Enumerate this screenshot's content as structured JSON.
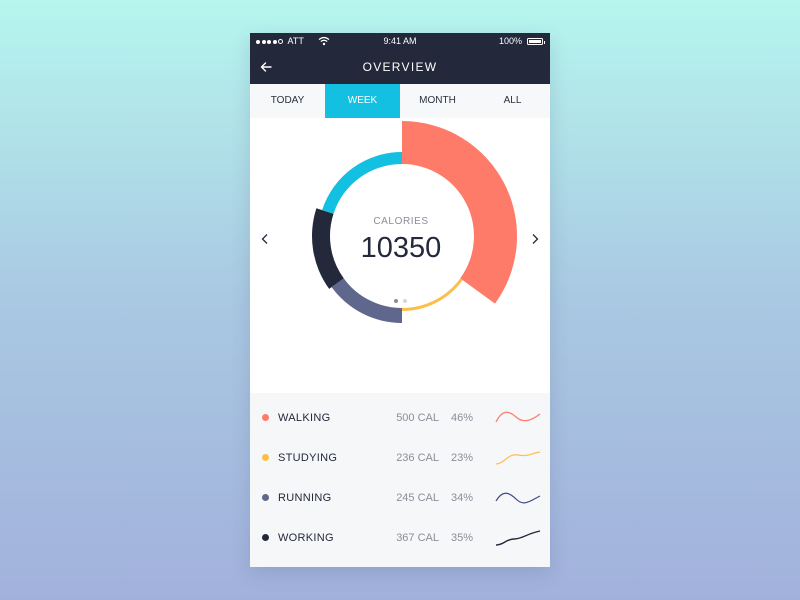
{
  "status_bar": {
    "carrier": "ATT",
    "time": "9:41 AM",
    "battery": "100%",
    "signal_bars_filled": 4,
    "signal_bars_total": 5
  },
  "nav": {
    "title": "OVERVIEW",
    "back_icon": "arrow-left-icon"
  },
  "tabs": [
    {
      "label": "TODAY",
      "active": false
    },
    {
      "label": "WEEK",
      "active": true
    },
    {
      "label": "MONTH",
      "active": false
    },
    {
      "label": "ALL",
      "active": false
    }
  ],
  "summary": {
    "label": "CALORIES",
    "value": "10350",
    "page_count": 2,
    "current_page": 1
  },
  "activities": [
    {
      "name": "WALKING",
      "calories": "500 CAL",
      "percent": "46%",
      "color": "#fd7b68"
    },
    {
      "name": "STUDYING",
      "calories": "236 CAL",
      "percent": "23%",
      "color": "#fcbf4c"
    },
    {
      "name": "RUNNING",
      "calories": "245 CAL",
      "percent": "34%",
      "color": "#5f688c"
    },
    {
      "name": "WORKING",
      "calories": "367 CAL",
      "percent": "35%",
      "color": "#23283b"
    }
  ],
  "colors": {
    "nav_bg": "#23283b",
    "accent": "#14c0e2",
    "walking": "#fd7b68",
    "studying": "#fcbf4c",
    "running": "#5f688c",
    "working": "#23283b",
    "extra_segment": "#14c0e2"
  },
  "chart_data": {
    "type": "pie",
    "title": "CALORIES",
    "total": 10350,
    "segments": [
      {
        "name": "WALKING",
        "value": 35,
        "color": "#fd7b68"
      },
      {
        "name": "STUDYING",
        "value": 15,
        "color": "#fcbf4c"
      },
      {
        "name": "RUNNING",
        "value": 15,
        "color": "#5f688c"
      },
      {
        "name": "WORKING",
        "value": 15,
        "color": "#23283b"
      },
      {
        "name": "",
        "value": 20,
        "color": "#14c0e2"
      }
    ]
  }
}
